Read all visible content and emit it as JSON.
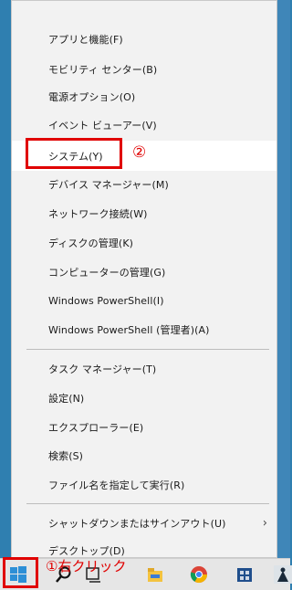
{
  "menu": {
    "items": [
      {
        "label": "アプリと機能(F)"
      },
      {
        "label": "モビリティ センター(B)"
      },
      {
        "label": "電源オプション(O)"
      },
      {
        "label": "イベント ビューアー(V)"
      },
      {
        "label": "システム(Y)"
      },
      {
        "label": "デバイス マネージャー(M)"
      },
      {
        "label": "ネットワーク接続(W)"
      },
      {
        "label": "ディスクの管理(K)"
      },
      {
        "label": "コンピューターの管理(G)"
      },
      {
        "label": "Windows PowerShell(I)"
      },
      {
        "label": "Windows PowerShell (管理者)(A)"
      },
      {
        "label": "タスク マネージャー(T)"
      },
      {
        "label": "設定(N)"
      },
      {
        "label": "エクスプローラー(E)"
      },
      {
        "label": "検索(S)"
      },
      {
        "label": "ファイル名を指定して実行(R)"
      },
      {
        "label": "シャットダウンまたはサインアウト(U)"
      },
      {
        "label": "デスクトップ(D)"
      }
    ]
  },
  "annotations": {
    "step2": "②",
    "step1": "①右クリック"
  },
  "colors": {
    "annotation": "#e00000",
    "menu_bg": "#f2f2f2",
    "desktop": "#2f7fb0"
  }
}
